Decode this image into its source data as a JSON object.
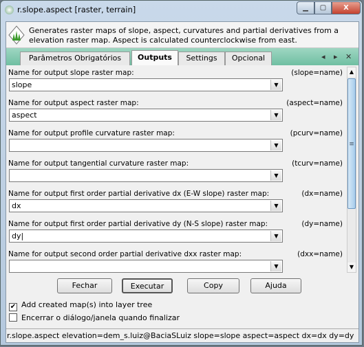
{
  "window": {
    "title": "r.slope.aspect [raster, terrain]",
    "minimize": "▁",
    "maximize": "▢",
    "close": "X"
  },
  "description": "Generates raster maps of slope, aspect, curvatures and partial derivatives from a elevation raster map. Aspect is calculated counterclockwise from east.",
  "tabs": [
    {
      "label": "Parâmetros Obrigatórios"
    },
    {
      "label": "Outputs",
      "active": true
    },
    {
      "label": "Settings"
    },
    {
      "label": "Opcional"
    }
  ],
  "tab_nav": {
    "prev": "◂",
    "next": "▸",
    "close": "✕"
  },
  "fields": [
    {
      "label": "Name for output slope raster map:",
      "key": "(slope=name)",
      "value": "slope"
    },
    {
      "label": "Name for output aspect raster map:",
      "key": "(aspect=name)",
      "value": "aspect"
    },
    {
      "label": "Name for output profile curvature raster map:",
      "key": "(pcurv=name)",
      "value": ""
    },
    {
      "label": "Name for output tangential curvature raster map:",
      "key": "(tcurv=name)",
      "value": ""
    },
    {
      "label": "Name for output first order partial derivative dx (E-W slope) raster  map:",
      "key": "(dx=name)",
      "value": "dx"
    },
    {
      "label": "Name for output first order partial derivative dy (N-S slope) raster  map:",
      "key": "(dy=name)",
      "value": "dy|"
    },
    {
      "label": "Name for output second order partial derivative dxx raster map:",
      "key": "(dxx=name)",
      "value": ""
    }
  ],
  "buttons": {
    "close": "Fechar",
    "run": "Executar",
    "copy": "Copy",
    "help": "Ajuda"
  },
  "checkboxes": [
    {
      "label": "Add created map(s) into layer tree",
      "checked": true,
      "mark": "✔"
    },
    {
      "label": "Encerrar o diálogo/janela quando finalizar",
      "checked": false,
      "mark": ""
    }
  ],
  "status": "r.slope.aspect elevation=dem_s.luiz@BaciaSLuiz slope=slope aspect=aspect dx=dx dy=dy",
  "scrollbar": {
    "position": 0.0,
    "visible_fraction": 0.65
  }
}
